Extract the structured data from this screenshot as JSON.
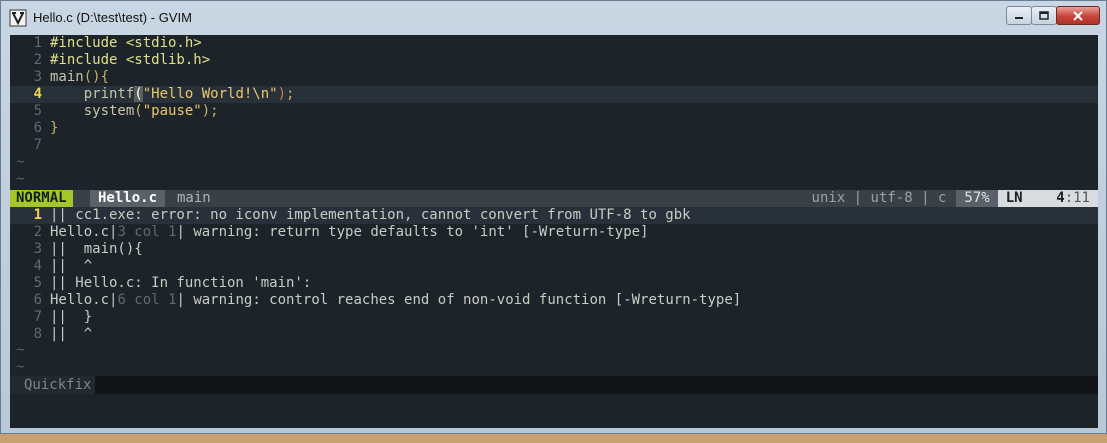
{
  "window": {
    "title": "Hello.c (D:\\test\\test) - GVIM"
  },
  "editor": {
    "lines": [
      {
        "num": "1",
        "parts": [
          {
            "t": "#include <stdio.h>",
            "c": "pre"
          }
        ]
      },
      {
        "num": "2",
        "parts": [
          {
            "t": "#include <stdlib.h>",
            "c": "pre"
          }
        ]
      },
      {
        "num": "3",
        "parts": [
          {
            "t": "main",
            "c": "fn"
          },
          {
            "t": "(){",
            "c": "kw"
          }
        ]
      },
      {
        "num": "4",
        "current": true,
        "parts": [
          {
            "t": "    printf",
            "c": "fn"
          },
          {
            "t": "(",
            "c": "cursor"
          },
          {
            "t": "\"Hello World!\\n\"",
            "c": "str"
          },
          {
            "t": ")",
            "c": "paren"
          },
          {
            "t": ";",
            "c": "kw"
          }
        ]
      },
      {
        "num": "5",
        "parts": [
          {
            "t": "    system",
            "c": "fn"
          },
          {
            "t": "(",
            "c": "kw"
          },
          {
            "t": "\"pause\"",
            "c": "str"
          },
          {
            "t": ");",
            "c": "kw"
          }
        ]
      },
      {
        "num": "6",
        "parts": [
          {
            "t": "}",
            "c": "kw"
          }
        ]
      },
      {
        "num": "7",
        "parts": []
      }
    ],
    "tilde": "~"
  },
  "statusline": {
    "mode": "NORMAL",
    "filename": "Hello.c",
    "function": "main",
    "info": "unix | utf-8 | c",
    "percent": "57%",
    "ln_label": "LN",
    "line": "4",
    "col": ":11"
  },
  "quickfix": {
    "lines": [
      {
        "num": "1",
        "current": true,
        "parts": [
          {
            "t": "|| cc1.exe: error: no iconv implementation, cannot convert from UTF-8 to gbk",
            "c": "qfl"
          }
        ]
      },
      {
        "num": "2",
        "parts": [
          {
            "t": "Hello.c",
            "c": "qfl"
          },
          {
            "t": "|",
            "c": "qfbar"
          },
          {
            "t": "3 col 1",
            "c": "qfdim"
          },
          {
            "t": "| warning: return type defaults to 'int' [-Wreturn-type]",
            "c": "qfl"
          }
        ]
      },
      {
        "num": "3",
        "parts": [
          {
            "t": "||  main(){",
            "c": "qfl"
          }
        ]
      },
      {
        "num": "4",
        "parts": [
          {
            "t": "||  ^",
            "c": "qfl"
          }
        ]
      },
      {
        "num": "5",
        "parts": [
          {
            "t": "|| Hello.c: In function 'main':",
            "c": "qfl"
          }
        ]
      },
      {
        "num": "6",
        "parts": [
          {
            "t": "Hello.c",
            "c": "qfl"
          },
          {
            "t": "|",
            "c": "qfbar"
          },
          {
            "t": "6 col 1",
            "c": "qfdim"
          },
          {
            "t": "| warning: control reaches end of non-void function [-Wreturn-type]",
            "c": "qfl"
          }
        ]
      },
      {
        "num": "7",
        "parts": [
          {
            "t": "||  }",
            "c": "qfl"
          }
        ]
      },
      {
        "num": "8",
        "parts": [
          {
            "t": "||  ^",
            "c": "qfl"
          }
        ]
      }
    ],
    "statusname": "Quickfix"
  }
}
